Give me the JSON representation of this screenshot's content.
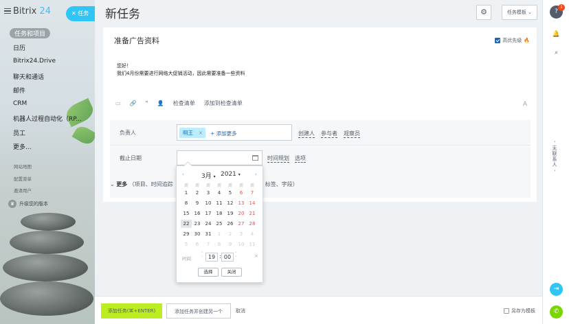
{
  "app": {
    "brand_main": "Bitrix",
    "brand_num": "24",
    "task_pill": "任务"
  },
  "sidebar": {
    "items": [
      {
        "label": "任务和项目",
        "active": true
      },
      {
        "label": "日历"
      },
      {
        "label": "Bitrix24.Drive"
      },
      {
        "label": "聊天和通话"
      },
      {
        "label": "邮件"
      },
      {
        "label": "CRM"
      },
      {
        "label": "机器人过程自动化（RP..."
      },
      {
        "label": "员工"
      },
      {
        "label": "更多..."
      }
    ],
    "small_items": [
      "网站地图",
      "配置菜单",
      "邀请用户"
    ],
    "upgrade": "升级您的版本"
  },
  "header": {
    "title": "新任务",
    "settings_icon": "gear-icon",
    "template_btn": "任务模板"
  },
  "task": {
    "name": "准备广告资料",
    "high_priority": "高优先级",
    "high_priority_checked": true,
    "desc_line1": "您好！",
    "desc_line2": "我们4月份需要进行网络大促销活动，因此需要准备一些资料"
  },
  "toolbar": {
    "checklist": "检查清单",
    "add_checklist": "添加到检查清单",
    "font_icon": "A"
  },
  "fields": {
    "responsible_label": "负责人",
    "responsible_tag": "明王",
    "add_more": "添加更多",
    "roles": [
      "创建人",
      "参与者",
      "观察员"
    ],
    "deadline_label": "截止日期",
    "time_planning": "时间规划",
    "options": "选项",
    "more_label": "更多",
    "more_hint_left": "（项目、时间追踪",
    "more_hint_right": "务、标签、字段）"
  },
  "calendar": {
    "month": "3月",
    "year": "2021",
    "weekdays": [
      "周一",
      "周二",
      "周三",
      "周四",
      "周五",
      "周六",
      "周日"
    ],
    "weekdays_short": [
      "周",
      "周",
      "周",
      "周",
      "周",
      "周",
      "周"
    ],
    "weeks": [
      [
        "1",
        "2",
        "3",
        "4",
        "5",
        "6",
        "7"
      ],
      [
        "8",
        "9",
        "10",
        "11",
        "12",
        "13",
        "14"
      ],
      [
        "15",
        "16",
        "17",
        "18",
        "19",
        "20",
        "21"
      ],
      [
        "22",
        "23",
        "24",
        "25",
        "26",
        "27",
        "28"
      ],
      [
        "29",
        "30",
        "31",
        "1",
        "2",
        "3",
        "4"
      ],
      [
        "5",
        "6",
        "7",
        "8",
        "9",
        "10",
        "11"
      ]
    ],
    "today": "22",
    "time_label": "时间",
    "hour": "19",
    "minute": "00",
    "select_btn": "选择",
    "close_btn": "关闭"
  },
  "footer": {
    "add_task": "添加任务(⌘+ENTER)",
    "add_and_create": "添加任务并创建另一个",
    "cancel": "取消",
    "save_template": "另存为模板"
  },
  "rightbar": {
    "help_badge": "1",
    "no_contacts": "- 无联系人 -"
  },
  "colors": {
    "accent": "#2fc6f6",
    "primary_btn": "#bbed21",
    "link": "#2067b0"
  }
}
